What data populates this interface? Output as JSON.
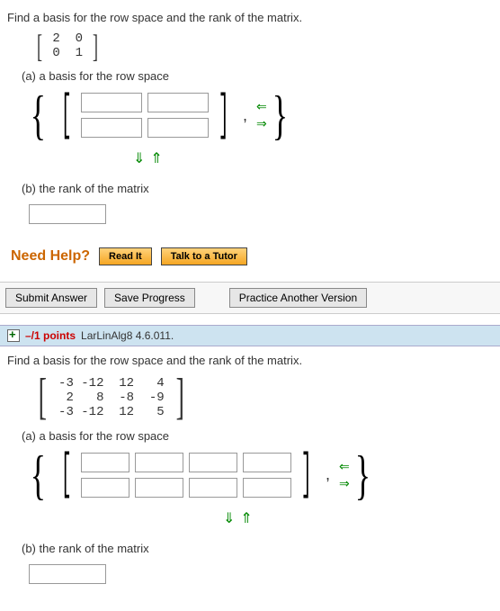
{
  "q1": {
    "prompt": "Find a basis for the row space and the rank of the matrix.",
    "matrix": [
      [
        2,
        0
      ],
      [
        0,
        1
      ]
    ],
    "part_a": "(a) a basis for the row space",
    "part_b": "(b) the rank of the matrix"
  },
  "help": {
    "label": "Need Help?",
    "read": "Read It",
    "tutor": "Talk to a Tutor"
  },
  "actions": {
    "submit": "Submit Answer",
    "save": "Save Progress",
    "practice": "Practice Another Version"
  },
  "header2": {
    "points_prefix": "–/1 points",
    "ref": "LarLinAlg8 4.6.011."
  },
  "q2": {
    "prompt": "Find a basis for the row space and the rank of the matrix.",
    "matrix": [
      [
        -3,
        -12,
        12,
        4
      ],
      [
        2,
        8,
        -8,
        -9
      ],
      [
        -3,
        -12,
        12,
        5
      ]
    ],
    "part_a": "(a) a basis for the row space",
    "part_b": "(b) the rank of the matrix"
  },
  "chart_data": [
    {
      "type": "table",
      "title": "Matrix Q1",
      "values": [
        [
          2,
          0
        ],
        [
          0,
          1
        ]
      ]
    },
    {
      "type": "table",
      "title": "Matrix Q2",
      "values": [
        [
          -3,
          -12,
          12,
          4
        ],
        [
          2,
          8,
          -8,
          -9
        ],
        [
          -3,
          -12,
          12,
          5
        ]
      ]
    }
  ]
}
